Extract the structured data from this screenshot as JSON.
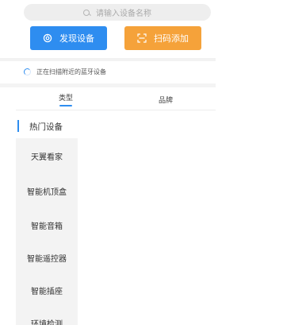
{
  "search": {
    "placeholder": "请输入设备名称"
  },
  "actions": {
    "discover_label": "发现设备",
    "scan_label": "扫码添加"
  },
  "status": {
    "scanning_text": "正在扫描附近的蓝牙设备"
  },
  "tabs": [
    {
      "label": "类型",
      "active": true
    },
    {
      "label": "品牌",
      "active": false
    }
  ],
  "categories": [
    {
      "label": "热门设备"
    },
    {
      "label": "天翼看家"
    },
    {
      "label": "智能机顶盒"
    },
    {
      "label": "智能音箱"
    },
    {
      "label": "智能遥控器"
    },
    {
      "label": "智能插座"
    },
    {
      "label": "环境检测"
    }
  ],
  "colors": {
    "accent": "#2e8df0",
    "scan_button": "#f5a23a",
    "highlight": "#a8302e"
  }
}
